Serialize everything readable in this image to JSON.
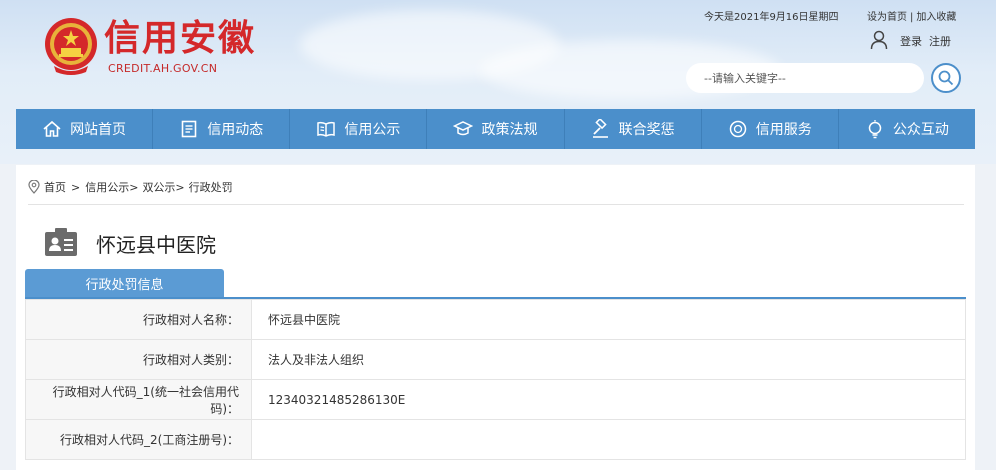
{
  "header": {
    "brand_title": "信用安徽",
    "brand_url": "CREDIT.AH.GOV.CN",
    "date_text": "今天是2021年9月16日星期四",
    "set_home": "设为首页",
    "add_fav": "加入收藏",
    "top_sep": "|",
    "login": "登录",
    "register": "注册",
    "search_placeholder": "--请输入关键字--"
  },
  "nav": [
    {
      "label": "网站首页",
      "icon": "home-icon"
    },
    {
      "label": "信用动态",
      "icon": "document-icon"
    },
    {
      "label": "信用公示",
      "icon": "book-icon"
    },
    {
      "label": "政策法规",
      "icon": "graduation-cap-icon"
    },
    {
      "label": "联合奖惩",
      "icon": "gavel-icon"
    },
    {
      "label": "信用服务",
      "icon": "badge-icon"
    },
    {
      "label": "公众互动",
      "icon": "bulb-icon"
    }
  ],
  "breadcrumb": [
    "首页",
    "信用公示>",
    "双公示>",
    "行政处罚"
  ],
  "breadcrumb_sep": ">",
  "entity_name": "怀远县中医院",
  "tab_label": "行政处罚信息",
  "rows": [
    {
      "label": "行政相对人名称：",
      "value": "怀远县中医院"
    },
    {
      "label": "行政相对人类别：",
      "value": "法人及非法人组织"
    },
    {
      "label": "行政相对人代码_1(统一社会信用代码)：",
      "value": "12340321485286130E"
    },
    {
      "label": "行政相对人代码_2(工商注册号)：",
      "value": ""
    }
  ],
  "colors": {
    "nav_bg": "#4b8fcb",
    "brand_red": "#d4282a",
    "tab_bg": "#5b9bd4"
  }
}
